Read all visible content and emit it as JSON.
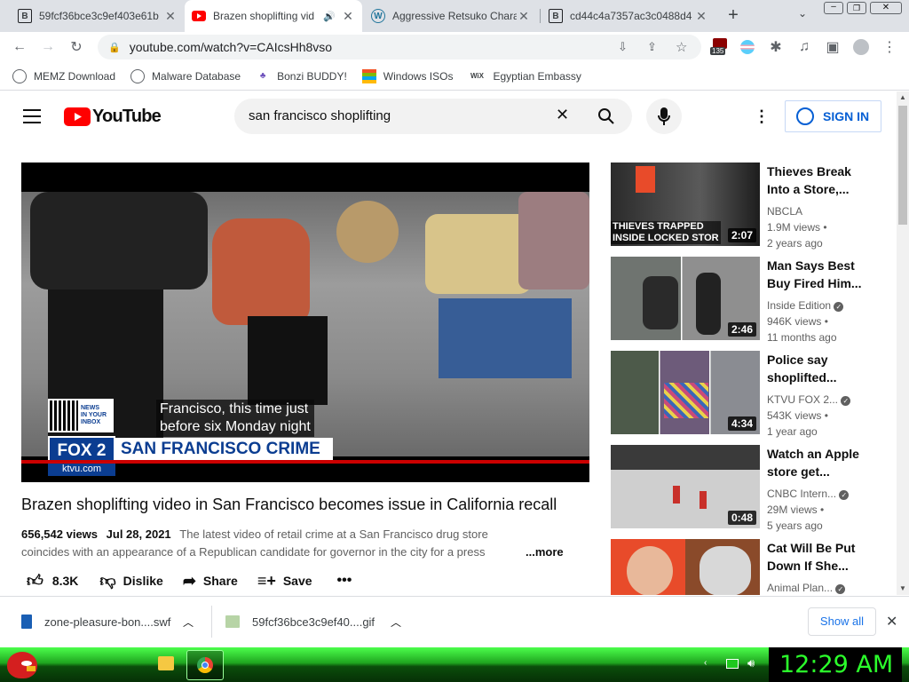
{
  "tabs": [
    {
      "title": "59fcf36bce3c9ef403e61b",
      "active": false,
      "icon": "b-icon"
    },
    {
      "title": "Brazen shoplifting vid",
      "active": true,
      "icon": "youtube-icon"
    },
    {
      "title": "Aggressive Retsuko Chara",
      "active": false,
      "icon": "wordpress-icon"
    },
    {
      "title": "cd44c4a7357ac3c0488d4",
      "active": false,
      "icon": "b-icon"
    }
  ],
  "toolbar": {
    "url": "youtube.com/watch?v=CAIcsHh8vso",
    "extension_badge": "135"
  },
  "bookmarks": [
    {
      "label": "MEMZ Download",
      "icon": "globe-icon"
    },
    {
      "label": "Malware Database",
      "icon": "globe-icon"
    },
    {
      "label": "Bonzi BUDDY!",
      "icon": "bonzi-icon"
    },
    {
      "label": "Windows ISOs",
      "icon": "windows-icon"
    },
    {
      "label": "Egyptian Embassy",
      "icon": "wix-icon"
    }
  ],
  "yt": {
    "logo_text": "YouTube",
    "search_value": "san francisco shoplifting",
    "sign_in": "SIGN IN"
  },
  "video": {
    "caption_line1": "Francisco, this time just",
    "caption_line2": "before six Monday night",
    "news_badge": "NEWS\nIN YOUR\nINBOX",
    "fox_logo": "FOX 2",
    "banner": "SAN FRANCISCO CRIME",
    "site": "ktvu.com",
    "title": "Brazen shoplifting video in San Francisco becomes issue in California recall",
    "views": "656,542 views",
    "date": "Jul 28, 2021",
    "desc_line1": "The latest video of retail crime at a San Francisco drug store",
    "desc_line2": "coincides with an appearance of a Republican candidate for governor in the city for a press",
    "more": "...more",
    "likes": "8.3K",
    "dislike": "Dislike",
    "share": "Share",
    "save": "Save"
  },
  "related": [
    {
      "title_line1": "Thieves Break",
      "title_line2": "Into a Store,...",
      "channel": "NBCLA",
      "verified": false,
      "views": "1.9M views",
      "age": "2 years ago",
      "duration": "2:07",
      "thumb_text": "THIEVES TRAPPED\nINSIDE LOCKED STOR"
    },
    {
      "title_line1": "Man Says Best",
      "title_line2": "Buy Fired Him...",
      "channel": "Inside Edition",
      "verified": true,
      "views": "946K views",
      "age": "11 months ago",
      "duration": "2:46",
      "thumb_text": ""
    },
    {
      "title_line1": "Police say",
      "title_line2": "shoplifted...",
      "channel": "KTVU FOX 2...",
      "verified": true,
      "views": "543K views",
      "age": "1 year ago",
      "duration": "4:34",
      "thumb_text": ""
    },
    {
      "title_line1": "Watch an Apple",
      "title_line2": "store get...",
      "channel": "CNBC Intern...",
      "verified": true,
      "views": "29M views",
      "age": "5 years ago",
      "duration": "0:48",
      "thumb_text": ""
    },
    {
      "title_line1": "Cat Will Be Put",
      "title_line2": "Down If She...",
      "channel": "Animal Plan...",
      "verified": true,
      "views": "",
      "age": "",
      "duration": "",
      "thumb_text": ""
    }
  ],
  "downloads": [
    {
      "name": "zone-pleasure-bon....swf"
    },
    {
      "name": "59fcf36bce3c9ef40....gif"
    }
  ],
  "download_show_all": "Show all",
  "taskbar": {
    "clock": "12:29 AM"
  },
  "colors": {
    "yt_red": "#ff0000",
    "signin_blue": "#065fd4",
    "clock_green": "#2bff2b"
  }
}
